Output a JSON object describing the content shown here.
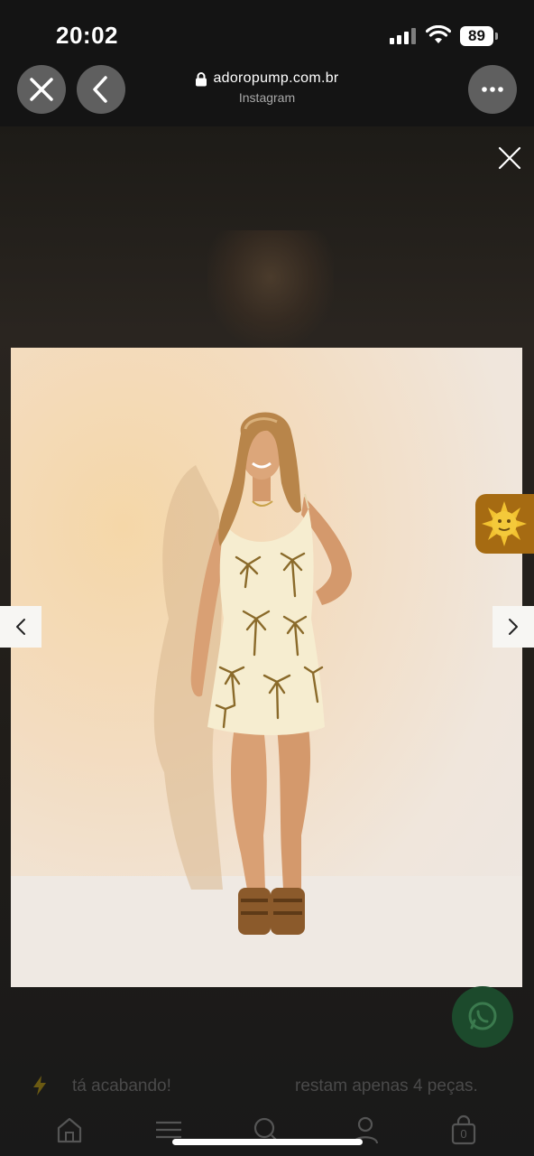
{
  "status_bar": {
    "time": "20:02",
    "battery": "89"
  },
  "browser": {
    "url": "adoropump.com.br",
    "subtitle": "Instagram"
  },
  "colors": {
    "background": "#141414",
    "sun_badge": "#a66b12",
    "whatsapp": "#1c4a2c",
    "dress": "#f6edd0",
    "palm_print": "#8a6a2a"
  },
  "icons": {
    "close_browser": "close-icon",
    "back_browser": "chevron-left-icon",
    "more_browser": "ellipsis-icon",
    "lock": "lock-icon",
    "modal_close": "close-icon",
    "prev": "chevron-left-icon",
    "next": "chevron-right-icon",
    "sun": "sun-icon",
    "whatsapp": "whatsapp-icon",
    "bolt": "bolt-icon",
    "home": "home-icon",
    "menu": "menu-icon",
    "search": "search-icon",
    "account": "user-icon",
    "bag": "bag-icon"
  },
  "promo": {
    "left_text": "tá acabando!",
    "right_text": "restam apenas 4 peças."
  },
  "bottom_nav": {
    "bag_count": "0"
  }
}
